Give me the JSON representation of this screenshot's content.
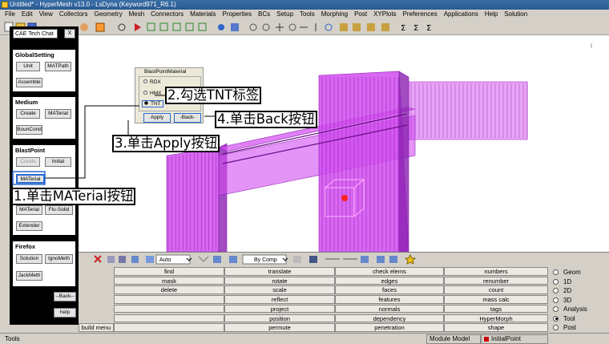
{
  "window": {
    "title": "Untitled* - HyperMesh v13.0 - LsDyna (Keyword971_R6.1)"
  },
  "menu": [
    "File",
    "Edit",
    "View",
    "Collectors",
    "Geometry",
    "Mesh",
    "Connectors",
    "Materials",
    "Properties",
    "BCs",
    "Setup",
    "Tools",
    "Morphing",
    "Post",
    "XYPlots",
    "Preferences",
    "Applications",
    "Help",
    "Solution"
  ],
  "tech_panel": {
    "title": "CAE Tech Chat",
    "close": "X",
    "groups": {
      "global": {
        "title": "GlobalSetting",
        "unit": "Unit",
        "matpath": "MATPath",
        "assemble": "Assemble"
      },
      "medium": {
        "title": "Medium",
        "create": "Create",
        "material": "MATerial",
        "boundcond": "BounCond"
      },
      "blast": {
        "title": "BlastPoint",
        "create": "Create",
        "initial": "Initial",
        "material": "MATerial"
      },
      "mid": {
        "material": "MATerial",
        "flusolid": "Flu-Solid",
        "extender": "Extender"
      },
      "firefox": {
        "title": "Firefox",
        "solution": "Solution",
        "ignometh": "IgnoMeth",
        "jackmeth": "JackMeth"
      },
      "back": "--Back--",
      "help": "help"
    }
  },
  "dialog": {
    "title": "BlastPointMaterial",
    "options": [
      {
        "label": "RDX",
        "selected": false
      },
      {
        "label": "HMX",
        "selected": false
      },
      {
        "label": "TNT",
        "selected": true
      }
    ],
    "apply": "Apply",
    "back": "-Back-"
  },
  "annotations": {
    "step1": "1.单击MATerial按钮",
    "step2": "2.勾选TNT标签",
    "step3": "3.单击Apply按钮",
    "step4": "4.单击Back按钮"
  },
  "bottom_toolbar": {
    "display_mode": "Auto",
    "color_mode": "By Comp"
  },
  "panels": {
    "col1": [
      "find",
      "mask",
      "delete"
    ],
    "col2": [
      "translate",
      "rotate",
      "scale",
      "reflect",
      "project",
      "position",
      "permute"
    ],
    "col3": [
      "check elems",
      "edges",
      "faces",
      "features",
      "normals",
      "dependency",
      "penetration"
    ],
    "col4": [
      "numbers",
      "renumber",
      "count",
      "mass calc",
      "tags",
      "HyperMorph",
      "shape"
    ],
    "left_partial": "build menu"
  },
  "page_radios": [
    {
      "label": "Geom",
      "selected": false
    },
    {
      "label": "1D",
      "selected": false
    },
    {
      "label": "2D",
      "selected": false
    },
    {
      "label": "3D",
      "selected": false
    },
    {
      "label": "Analysis",
      "selected": false
    },
    {
      "label": "Tool",
      "selected": true
    },
    {
      "label": "Post",
      "selected": false
    }
  ],
  "status": {
    "left": "Tools",
    "module": "Module Model",
    "component": "InitialPoint",
    "component_color": "#cc0000"
  },
  "colors": {
    "model_magenta": "#d24cf0",
    "model_dark": "#8a1fb0",
    "blast_red": "#ff2020"
  }
}
